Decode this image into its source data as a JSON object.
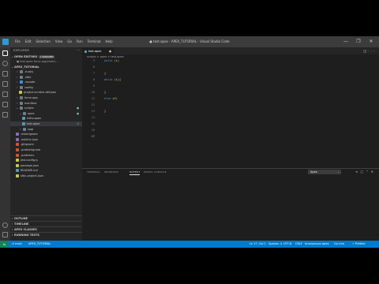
{
  "titlebar": {
    "menu": [
      "File",
      "Edit",
      "Selection",
      "View",
      "Go",
      "Run",
      "Terminal",
      "Help"
    ],
    "title": "●  test.apex - APEX_TUTORIAL - Visual Studio Code",
    "controls": [
      "—",
      "❐",
      "✕"
    ]
  },
  "explorer": {
    "header": "EXPLORER",
    "open_editors_label": "OPEN EDITORS",
    "open_editors_badge": "1 UNSAVED",
    "open_file": "● test.apex  force-app\\main\\...",
    "project_label": "APEX_TUTORIAL",
    "tree": [
      {
        "label": ".husky",
        "type": "folder",
        "icon_color": "#6d8086"
      },
      {
        "label": ".sfdx",
        "type": "folder",
        "icon_color": "#6d8086"
      },
      {
        "label": ".vscode",
        "type": "folder",
        "icon_color": "#3a96dd"
      },
      {
        "label": "config",
        "type": "folder",
        "icon_color": "#6d8086"
      },
      {
        "label": "project-scratch-def.json",
        "type": "file",
        "icon_color": "#cbcb41"
      },
      {
        "label": "force-app",
        "type": "folder",
        "icon_color": "#6d8086"
      },
      {
        "label": "manifest",
        "type": "folder",
        "icon_color": "#6d8086"
      },
      {
        "label": "scripts",
        "type": "folder-open",
        "icon_color": "#6d8086",
        "mark": "●"
      },
      {
        "label": "apex",
        "type": "folder-open",
        "icon_color": "#6d8086",
        "mark": "●"
      },
      {
        "label": "hello.apex",
        "type": "file",
        "icon_color": "#519aba"
      },
      {
        "label": "test.apex",
        "type": "file",
        "icon_color": "#519aba",
        "mark": "U",
        "selected": true
      },
      {
        "label": "soql",
        "type": "folder",
        "icon_color": "#6d8086"
      },
      {
        "label": ".eslintignore",
        "type": "file",
        "icon_color": "#8b6cc2"
      },
      {
        "label": ".eslintrc.json",
        "type": "file",
        "icon_color": "#8b6cc2"
      },
      {
        "label": ".gitignore",
        "type": "file",
        "icon_color": "#e44d26"
      },
      {
        "label": ".prettierignore",
        "type": "file",
        "icon_color": "#e44d26"
      },
      {
        "label": ".prettierrc",
        "type": "file",
        "icon_color": "#e44d26"
      },
      {
        "label": "jest.config.js",
        "type": "file",
        "icon_color": "#cbcb41"
      },
      {
        "label": "package.json",
        "type": "file",
        "icon_color": "#cbcb41"
      },
      {
        "label": "README.md",
        "type": "file",
        "icon_color": "#519aba"
      },
      {
        "label": "sfdx-project.json",
        "type": "file",
        "icon_color": "#cbcb41"
      }
    ],
    "bottom_sections": [
      "OUTLINE",
      "TIMELINE",
      "APEX CLASSES",
      "RUNNING TESTS"
    ]
  },
  "editor": {
    "tab_label": "test.apex",
    "tab_modified": "●",
    "breadcrumbs": "scripts > apex > test.apex",
    "line_numbers": [
      "5",
      "6",
      "7",
      "8",
      "9",
      "10",
      "11",
      "12",
      "13",
      "14",
      "15",
      "16",
      "17"
    ],
    "current_line": "17"
  },
  "panel": {
    "tabs": [
      "TERMINAL",
      "PROBLEMS",
      "OUTPUT",
      "DEBUG CONSOLE"
    ],
    "active_tab": "OUTPUT",
    "channel": "Apex"
  },
  "statusbar": {
    "remote": "⇋",
    "branch": "⎇ main",
    "org": "APEX_TUTORIAL",
    "position": "Ln 17, Col 1",
    "spaces": "Spaces: 4",
    "encoding": "UTF-8",
    "eol": "CRLF",
    "language": "Anonymous Apex",
    "golive": "Go Live",
    "prettier": "✓ Prettier"
  },
  "colors": {
    "statusbar": "#007acc",
    "activitybar": "#333333",
    "sidebar": "#252526",
    "editor": "#1e1e1e"
  }
}
